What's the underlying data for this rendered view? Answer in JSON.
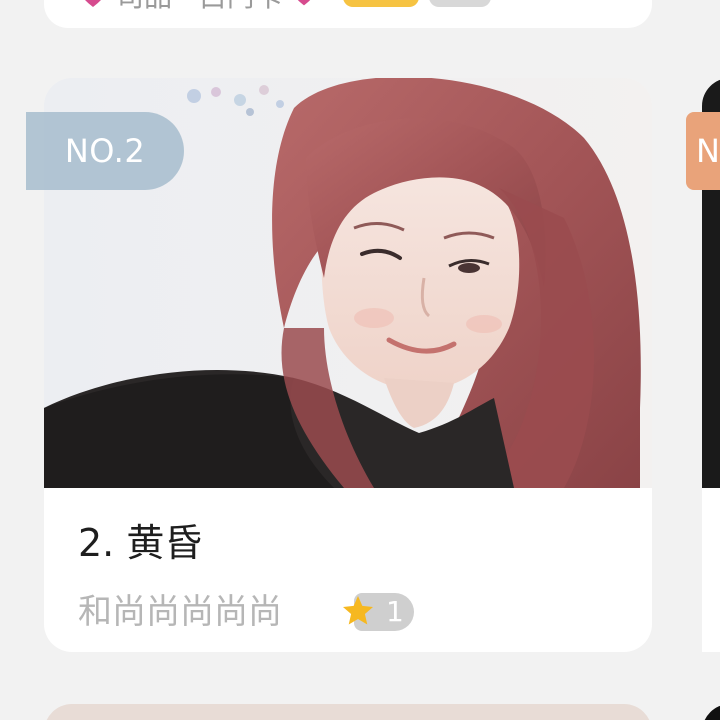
{
  "top_card": {
    "text": "司品 · 白鬥卡"
  },
  "main_card": {
    "rank_badge": "NO.2",
    "title": "2. 黄昏",
    "subtitle": "和尚尚尚尚尚",
    "star_count": "1"
  },
  "side_card": {
    "badge_partial": "N"
  },
  "colors": {
    "background": "#f2f2f2",
    "card": "#ffffff",
    "rank_badge": "#a8bece",
    "side_badge": "#e9a37a",
    "star": "#f6b820",
    "subtitle": "#b6b6b6"
  },
  "icons": {
    "star": "star-icon",
    "heart": "heart-icon"
  }
}
